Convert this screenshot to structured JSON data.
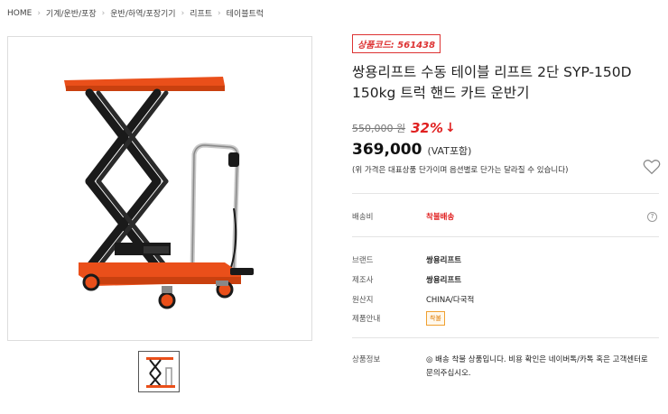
{
  "breadcrumb": [
    "HOME",
    "기계/운반/포장",
    "운반/하역/포장기기",
    "리프트",
    "테이블트럭"
  ],
  "product": {
    "code_label": "상품코드: 561438",
    "title_line1": "쌍용리프트 수동 테이블 리프트 2단 SYP-150D",
    "title_line2": "150kg 트럭 핸드 카트 운반기",
    "original_price": "550,000 원",
    "discount": "32%",
    "sale_price": "369,000",
    "vat_label": "(VAT포함)",
    "notice": "(위 가격은 대표상품 단가이며 옵션별로 단가는 달라질 수 있습니다)"
  },
  "shipping": {
    "label": "배송비",
    "value": "착불배송",
    "help": "?"
  },
  "specs": [
    {
      "label": "브랜드",
      "value": "쌍용리프트"
    },
    {
      "label": "제조사",
      "value": "쌍용리프트"
    },
    {
      "label": "원산지",
      "value": "CHINA/다국적"
    }
  ],
  "notice_row": {
    "label": "제품안내",
    "tag": "착불"
  },
  "info_row": {
    "label": "상품정보",
    "value": "◎ 배송 착불 상품입니다. 비용 확인은 네이버톡/카톡 혹은 고객센터로 문의주십시오."
  },
  "colors": {
    "accent": "#e02020",
    "lift_orange": "#ea4f1a",
    "frame": "#1a1a1a"
  },
  "icons": {
    "wishlist": "heart-icon",
    "discount_arrow": "down-arrow-icon"
  }
}
